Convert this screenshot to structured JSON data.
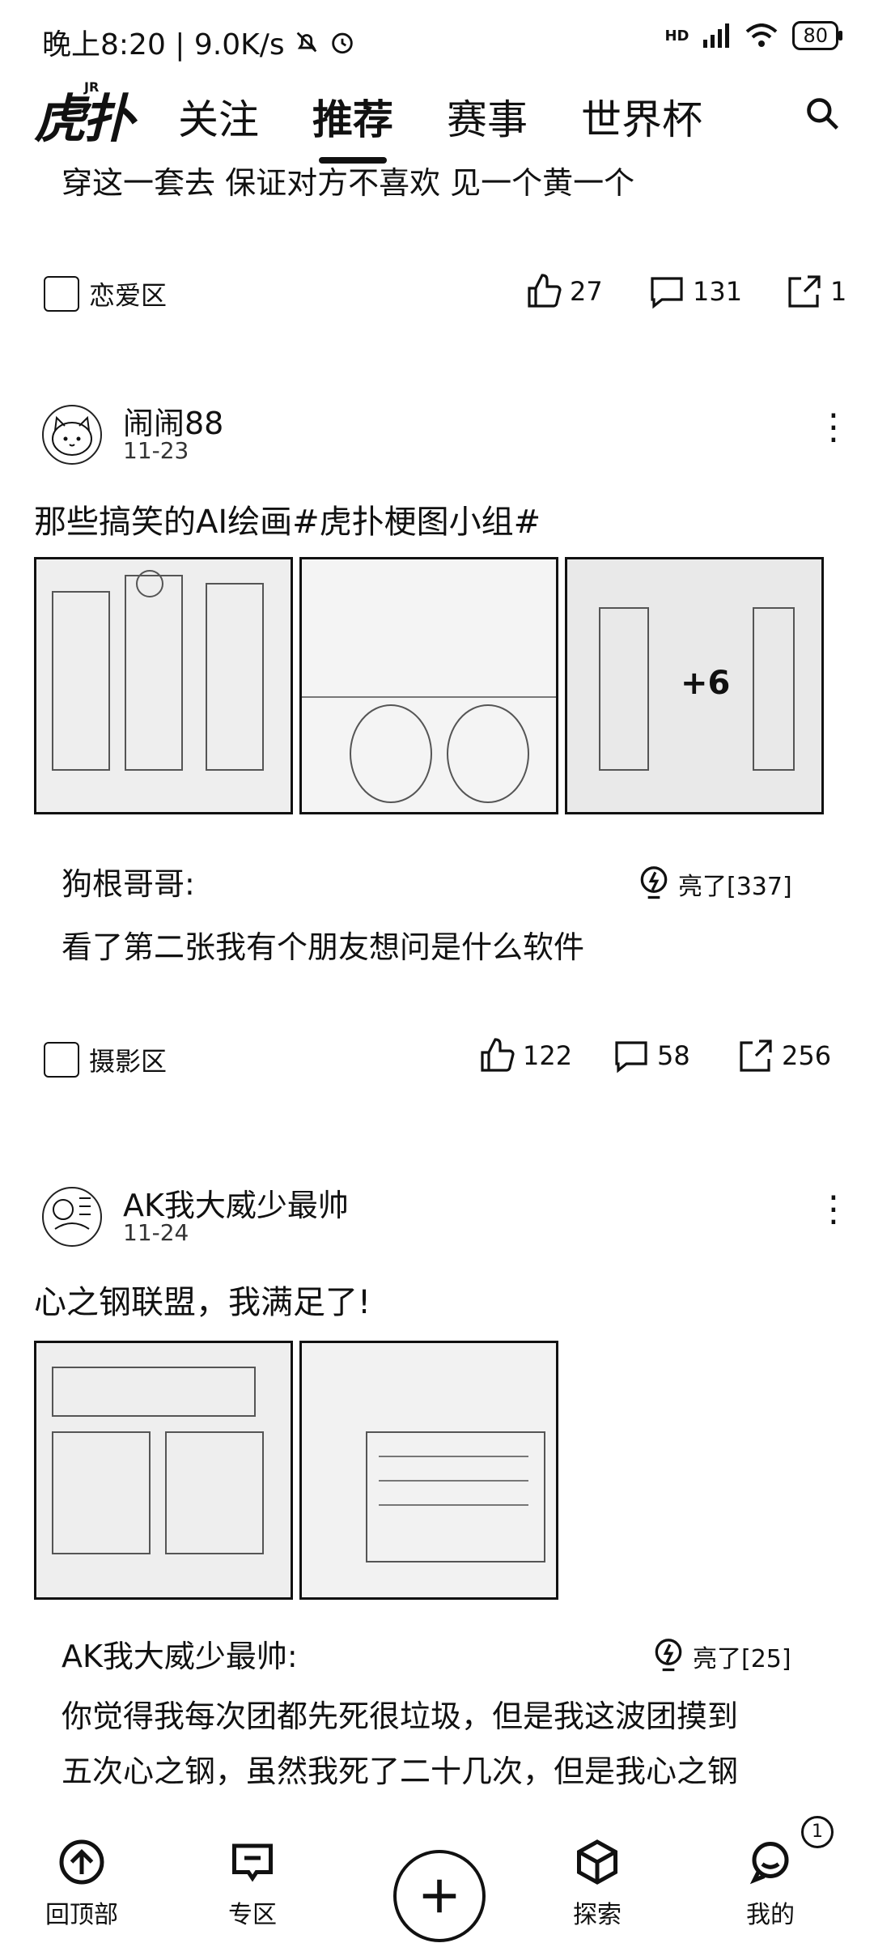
{
  "status_bar": {
    "time_speed": "晚上8:20 | 9.0K/s",
    "battery": "80",
    "network_label": "HD"
  },
  "nav": {
    "logo_text": "虎扑",
    "logo_sup": "JR",
    "tabs": [
      {
        "label": "关注"
      },
      {
        "label": "推荐"
      },
      {
        "label": "赛事"
      },
      {
        "label": "世界杯"
      }
    ]
  },
  "post0": {
    "text": "穿这一套去 保证对方不喜欢 见一个黄一个",
    "zone": "恋爱区",
    "likes": "27",
    "comments": "131",
    "shares": "1"
  },
  "post1": {
    "username": "闹闹88",
    "date": "11-23",
    "title": "那些搞笑的AI绘画#虎扑梗图小组#",
    "more_images": "+6",
    "comment_user": "狗根哥哥:",
    "comment_lit": "亮了[337]",
    "comment_text": "看了第二张我有个朋友想问是什么软件",
    "zone": "摄影区",
    "likes": "122",
    "comments": "58",
    "shares": "256"
  },
  "post2": {
    "username": "AK我大威少最帅",
    "date": "11-24",
    "title": "心之钢联盟，我满足了!",
    "comment_user": "AK我大威少最帅:",
    "comment_lit": "亮了[25]",
    "comment_line1": "你觉得我每次团都先死很垃圾，但是我这波团摸到",
    "comment_line2": "五次心之钢，虽然我死了二十几次，但是我心之钢"
  },
  "bottom_bar": {
    "back_top": "回顶部",
    "zone": "专区",
    "explore": "探索",
    "mine": "我的",
    "mine_badge": "1"
  },
  "icons": {
    "search": "search-icon",
    "like": "thumbs-up-icon",
    "comment": "comment-icon",
    "share": "share-icon",
    "more": "more-vertical-icon",
    "lit": "lightbulb-icon",
    "plus": "plus-icon"
  }
}
